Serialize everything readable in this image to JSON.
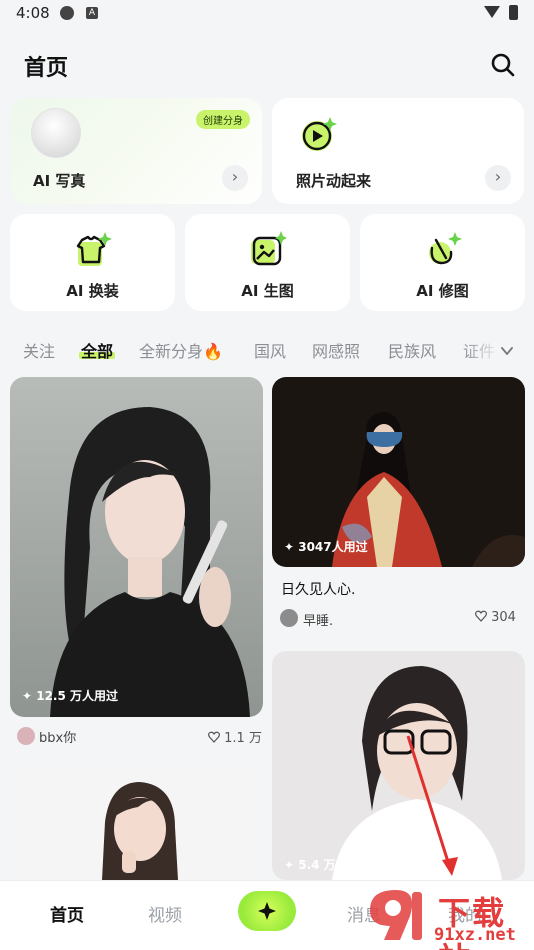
{
  "status_bar": {
    "time": "4:08",
    "icon_a": "A"
  },
  "header": {
    "title": "首页"
  },
  "feature_cards": {
    "ai_write": {
      "label": "AI 写真",
      "badge": "创建分身"
    },
    "photo_animate": {
      "label": "照片动起来"
    },
    "ai_swap": {
      "label": "AI 换装"
    },
    "ai_generate": {
      "label": "AI 生图"
    },
    "ai_retouch": {
      "label": "AI 修图"
    }
  },
  "category_tabs": [
    "关注",
    "全部",
    "全新分身🔥",
    "国风",
    "网感照",
    "民族风",
    "证件"
  ],
  "active_tab": "全部",
  "feed": {
    "left_1": {
      "used": "12.5 万人用过",
      "author": "bbx你",
      "likes": "1.1 万"
    },
    "right_1": {
      "used": "3047人用过",
      "title": "日久见人心.",
      "author": "早睡.",
      "likes": "304"
    },
    "right_2": {
      "used": "5.4 万人用过"
    }
  },
  "bottom_nav": {
    "home": "首页",
    "video": "视频",
    "messages": "消息",
    "profile": "我的"
  },
  "watermark": {
    "brand": "下载站",
    "url": "91xz.net"
  },
  "colors": {
    "accent": "#c9f36a",
    "watermark_red": "#e33d3d"
  }
}
